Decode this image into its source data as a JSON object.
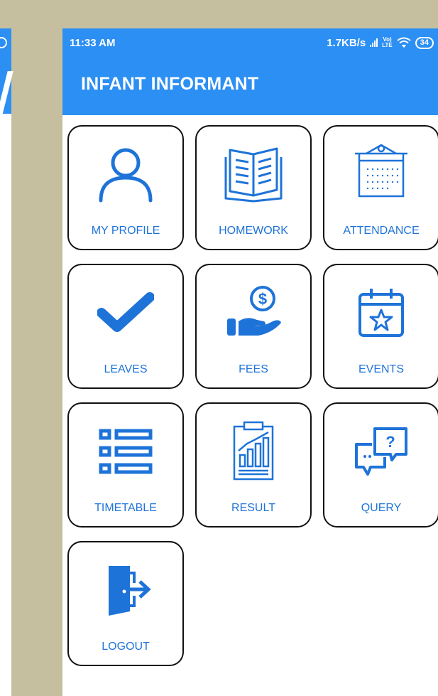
{
  "status_bar": {
    "time": "11:33 AM",
    "net_speed": "1.7KB/s",
    "lte_top": "Vo)",
    "lte_bottom": "LTE",
    "battery": "34"
  },
  "header": {
    "title": "INFANT INFORMANT"
  },
  "colors": {
    "primary": "#2c8ff3",
    "icon": "#1e73d8",
    "label": "#1e73d8",
    "backdrop": "#c6bf9f"
  },
  "tiles": [
    {
      "label": "MY PROFILE",
      "icon": "person-icon"
    },
    {
      "label": "HOMEWORK",
      "icon": "open-book-icon"
    },
    {
      "label": "ATTENDANCE",
      "icon": "calendar-icon"
    },
    {
      "label": "LEAVES",
      "icon": "checkmark-icon"
    },
    {
      "label": "FEES",
      "icon": "hand-coin-icon"
    },
    {
      "label": "EVENTS",
      "icon": "event-calendar-icon"
    },
    {
      "label": "TIMETABLE",
      "icon": "list-icon"
    },
    {
      "label": "RESULT",
      "icon": "report-chart-icon"
    },
    {
      "label": "QUERY",
      "icon": "chat-question-icon"
    },
    {
      "label": "LOGOUT",
      "icon": "exit-door-icon"
    }
  ]
}
